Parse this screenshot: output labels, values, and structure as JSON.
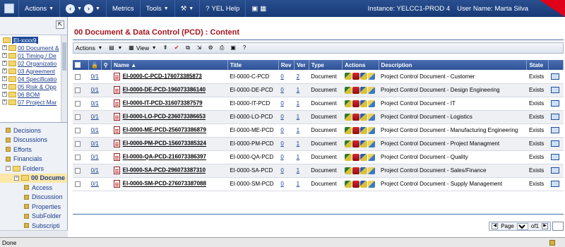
{
  "topbar": {
    "actions_label": "Actions",
    "metrics_label": "Metrics",
    "tools_label": "Tools",
    "help_label": "YEL Help",
    "instance": "Instance: YELCC1-PROD 4",
    "user": "User Name: Marta Silva"
  },
  "tree": {
    "root": "EI-xxxx9",
    "items": [
      "00 Document &",
      "01 Timing / De",
      "02 Organizatio",
      "03 Agreement",
      "04 Specificatio",
      "05 Risk & Opp",
      "06 BOM",
      "07 Project Mar"
    ]
  },
  "nav": {
    "items": [
      "Decisions",
      "Discussions",
      "Efforts",
      "Financials"
    ],
    "folders_label": "Folders",
    "selected_folder": "00 Docume",
    "subitems": [
      "Access",
      "Discussion",
      "Properties",
      "SubFolder",
      "Subscripti"
    ]
  },
  "page": {
    "title": "00 Document & Data Control (PCD) : Content"
  },
  "toolbar": {
    "actions_label": "Actions",
    "view_label": "View"
  },
  "table": {
    "headers": {
      "name": "Name",
      "title": "Title",
      "rev": "Rev",
      "ver": "Ver",
      "type": "Type",
      "actions": "Actions",
      "description": "Description",
      "state": "State"
    },
    "rows": [
      {
        "count": "0/1",
        "name": "EI-0000-C-PCD-176073385873",
        "title": "EI-0000-C-PCD",
        "rev": "0",
        "ver": "2",
        "type": "Document",
        "description": "Project Control Document - Customer",
        "state": "Exists"
      },
      {
        "count": "0/1",
        "name": "EI-0000-DE-PCD-196073386140",
        "title": "EI-0000-DE-PCD",
        "rev": "0",
        "ver": "1",
        "type": "Document",
        "description": "Project Control Document - Design Engineering",
        "state": "Exists"
      },
      {
        "count": "0/1",
        "name": "EI-0000-IT-PCD-316073387579",
        "title": "EI-0000-IT-PCD",
        "rev": "0",
        "ver": "1",
        "type": "Document",
        "description": "Project Control Document - IT",
        "state": "Exists"
      },
      {
        "count": "0/1",
        "name": "EI-0000-LO-PCD-236073386653",
        "title": "EI-0000-LO-PCD",
        "rev": "0",
        "ver": "1",
        "type": "Document",
        "description": "Project Control Document - Logistics",
        "state": "Exists"
      },
      {
        "count": "0/1",
        "name": "EI-0000-ME-PCD-256073386879",
        "title": "EI-0000-ME-PCD",
        "rev": "0",
        "ver": "1",
        "type": "Document",
        "description": "Project Control Document - Manufacturing Engineering",
        "state": "Exists"
      },
      {
        "count": "0/1",
        "name": "EI-0000-PM-PCD-156073385324",
        "title": "EI-0000-PM-PCD",
        "rev": "0",
        "ver": "1",
        "type": "Document",
        "description": "Project Control Document - Project Managment",
        "state": "Exists"
      },
      {
        "count": "0/1",
        "name": "EI-0000-QA-PCD-216073386397",
        "title": "EI-0000-QA-PCD",
        "rev": "0",
        "ver": "1",
        "type": "Document",
        "description": "Project Control Document - Quality",
        "state": "Exists"
      },
      {
        "count": "0/1",
        "name": "EI-0000-SA-PCD-296073387310",
        "title": "EI-0000-SA-PCD",
        "rev": "0",
        "ver": "1",
        "type": "Document",
        "description": "Project Control Document - Sales/Finance",
        "state": "Exists"
      },
      {
        "count": "0/1",
        "name": "EI-0000-SM-PCD-276073387088",
        "title": "EI-0000-SM-PCD",
        "rev": "0",
        "ver": "1",
        "type": "Document",
        "description": "Project Control Document - Supply Management",
        "state": "Exists"
      }
    ]
  },
  "pager": {
    "page_label": "Page",
    "page_value": "1",
    "of_label": "of1"
  },
  "status": {
    "text": "Done"
  },
  "colors": {
    "topbar": "#173a76",
    "title_red": "#a6141e",
    "header_blue": "#2d5296"
  },
  "icons": [
    "back-icon",
    "forward-icon",
    "tools-icon",
    "help-icon",
    "pin-icon",
    "folder-icon",
    "document-icon",
    "lock-icon",
    "state-icon"
  ]
}
